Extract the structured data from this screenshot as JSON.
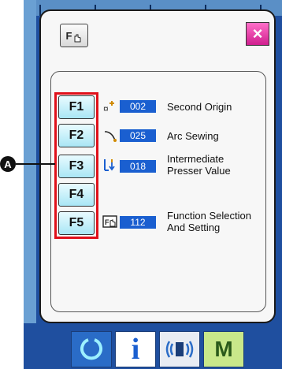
{
  "dialog": {
    "fkey_icon_label": "F",
    "close_label": "×"
  },
  "marker": {
    "label": "A"
  },
  "function_keys": [
    "F1",
    "F2",
    "F3",
    "F4",
    "F5"
  ],
  "rows": [
    {
      "code": "002",
      "label_lines": [
        "Second Origin"
      ],
      "icon": "second-origin-icon"
    },
    {
      "code": "025",
      "label_lines": [
        "Arc Sewing"
      ],
      "icon": "arc-sewing-icon"
    },
    {
      "code": "018",
      "label_lines": [
        "Intermediate",
        "Presser Value"
      ],
      "icon": "presser-value-icon"
    },
    {
      "code": "112",
      "label_lines": [
        "Function Selection",
        "And Setting"
      ],
      "icon": "function-selection-icon"
    }
  ],
  "bottom_bar": {
    "buttons": [
      {
        "name": "refresh-icon",
        "label": ""
      },
      {
        "name": "info-icon",
        "label": "i"
      },
      {
        "name": "communication-icon",
        "label": ""
      },
      {
        "name": "mode-button",
        "label": "M"
      }
    ]
  },
  "colors": {
    "accent_blue": "#1a5fd0",
    "frame_red": "#e0101a",
    "close_magenta": "#d01f8f",
    "key_cyan": "#a9e6f5",
    "nav_green": "#c9e88a",
    "nav_blue": "#2a6cc7"
  }
}
